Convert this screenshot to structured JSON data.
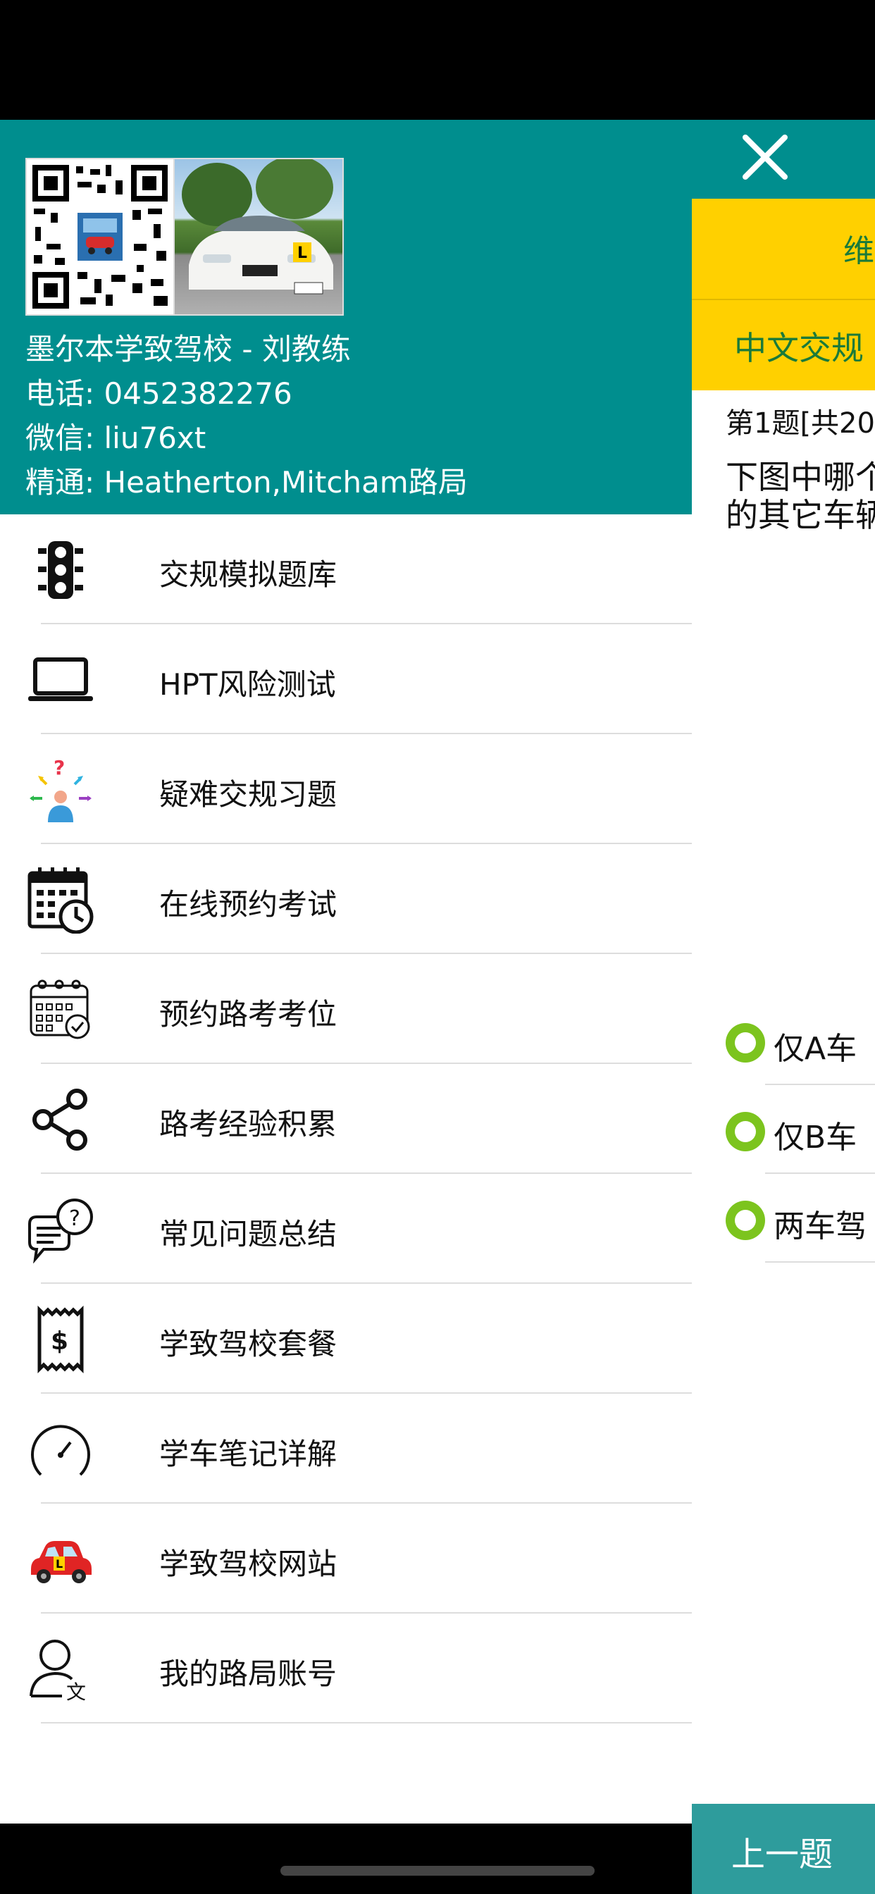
{
  "background_page": {
    "yellow_title": "维",
    "yellow_subtitle": "中文交规",
    "question_number": "第1题[共20",
    "question_line1": "下图中哪个",
    "question_line2": "的其它车辆",
    "options": [
      {
        "label": "仅A车"
      },
      {
        "label": "仅B车"
      },
      {
        "label": "两车驾"
      }
    ],
    "prev_label": "上一题"
  },
  "drawer": {
    "header": {
      "school_line": "墨尔本学致驾校 - 刘教练",
      "phone_line": "电话: 0452382276",
      "wechat_line": "微信: liu76xt",
      "expert_line": "精通: Heatherton,Mitcham路局"
    },
    "menu": [
      {
        "label": "交规模拟题库",
        "icon": "traffic-light-icon"
      },
      {
        "label": "HPT风险测试",
        "icon": "laptop-icon"
      },
      {
        "label": "疑难交规习题",
        "icon": "confused-person-icon"
      },
      {
        "label": "在线预约考试",
        "icon": "calendar-clock-icon"
      },
      {
        "label": "预约路考考位",
        "icon": "calendar-check-icon"
      },
      {
        "label": "路考经验积累",
        "icon": "share-icon"
      },
      {
        "label": "常见问题总结",
        "icon": "question-chat-icon"
      },
      {
        "label": "学致驾校套餐",
        "icon": "receipt-dollar-icon"
      },
      {
        "label": "学车笔记详解",
        "icon": "speedometer-icon"
      },
      {
        "label": "学致驾校网站",
        "icon": "red-car-icon"
      },
      {
        "label": "我的路局账号",
        "icon": "user-translate-icon"
      }
    ]
  },
  "colors": {
    "teal": "#008e8e",
    "yellow": "#ffd000",
    "radio_green": "#7cc41e"
  }
}
